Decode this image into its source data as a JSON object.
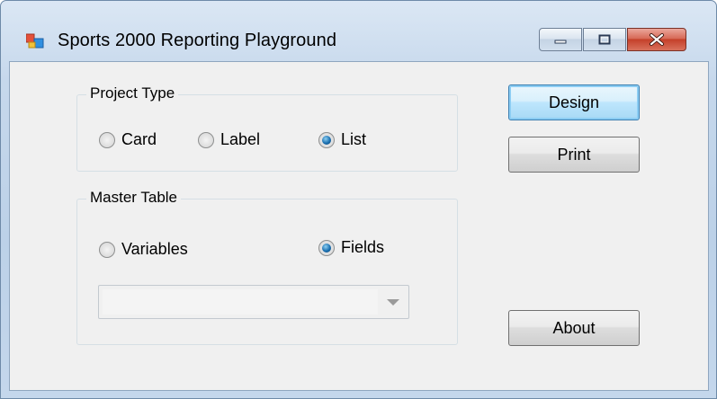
{
  "window": {
    "title": "Sports 2000 Reporting Playground",
    "accent": "#3c7fb1"
  },
  "caption_buttons": {
    "minimize_icon": "minimize-icon",
    "maximize_icon": "maximize-icon",
    "close_icon": "close-icon"
  },
  "project_type": {
    "label": "Project Type",
    "options": [
      {
        "label": "Card",
        "selected": false
      },
      {
        "label": "Label",
        "selected": false
      },
      {
        "label": "List",
        "selected": true
      }
    ]
  },
  "master_table": {
    "label": "Master Table",
    "options": [
      {
        "label": "Variables",
        "selected": false
      },
      {
        "label": "Fields",
        "selected": true
      }
    ],
    "combo": {
      "value": "",
      "enabled": false
    }
  },
  "buttons": {
    "design": "Design",
    "print": "Print",
    "about": "About"
  }
}
